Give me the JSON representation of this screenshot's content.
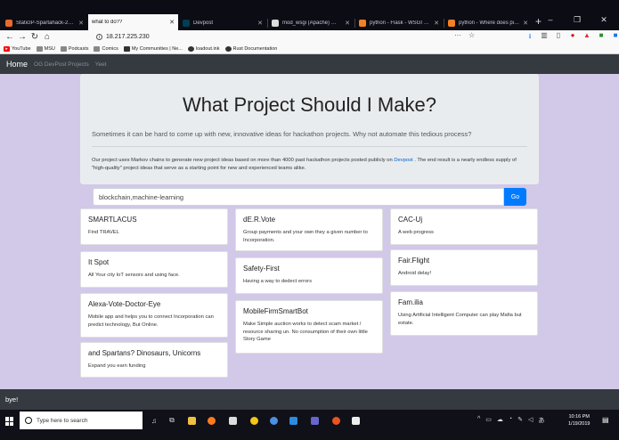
{
  "browser": {
    "tabs": [
      {
        "label": "StaticIP-Spartahack-2019 | Lo",
        "color": "#e86a2c",
        "active": false
      },
      {
        "label": "what to do??",
        "color": "#ffffff",
        "active": true
      },
      {
        "label": "Devpost",
        "color": "#003e54",
        "active": false
      },
      {
        "label": "mod_wsgi (Apache) — Flask",
        "color": "#dddddd",
        "active": false
      },
      {
        "label": "python - Flask - WSGI - No m",
        "color": "#f48024",
        "active": false
      },
      {
        "label": "python - Where does pip ins",
        "color": "#f48024",
        "active": false
      }
    ],
    "new_tab": "+",
    "window_controls": {
      "minimize": "–",
      "maximize": "❐",
      "close": "✕"
    },
    "url": "18.217.225.230",
    "url_actions": {
      "more": "···",
      "star": "☆"
    },
    "bookmarks": [
      {
        "label": "YouTube",
        "icon_color": "#ff0000"
      },
      {
        "label": "MSU",
        "icon_color": "#888888"
      },
      {
        "label": "Podcasts",
        "icon_color": "#888888"
      },
      {
        "label": "Comics",
        "icon_color": "#888888"
      },
      {
        "label": "My Communities | Ne...",
        "icon_color": "#333333"
      },
      {
        "label": "loadout.ink",
        "icon_color": "#333333"
      },
      {
        "label": "Rust Documentation",
        "icon_color": "#333333"
      }
    ]
  },
  "site": {
    "brand": "Home",
    "nav_links": [
      "OG DevPost Projects",
      "Yeet"
    ],
    "title": "What Project Should I Make?",
    "lead": "Sometimes it can be hard to come up with new, innovative ideas for hackathon projects. Why not automate this tedious process?",
    "desc_before": "Our project uses Markov chains to generate new project ideas based on more than 4000 past hackathon projects posted publicly on ",
    "desc_link": "Devpost",
    "desc_after": " . The end result is a nearly endless supply of \"high-quality\" project ideas that serve as a starting point for new and experienced teams alike.",
    "search_value": "blockchain,machine-learning",
    "go_label": "Go",
    "footer": "bye!"
  },
  "cards": [
    {
      "title": "SMARTLACUS",
      "text": "Find TRAVEL"
    },
    {
      "title": "dE.R.Vote",
      "text": "Group payments and your own they a given number to Incorporation."
    },
    {
      "title": "CAC-Uj",
      "text": "A web progress"
    },
    {
      "title": "It Spot",
      "text": "All Your city IoT sensors and using face."
    },
    {
      "title": "Safety-First",
      "text": "Having a way to dedect errors"
    },
    {
      "title": "Fair.Flight",
      "text": "Android delay!"
    },
    {
      "title": "Alexa-Vote-Doctor-Eye",
      "text": "Mobile app and helps you to connect Incorporation can predict technology, But Online."
    },
    {
      "title": "MobileFirmSmartBot",
      "text": "Make Simple auction works to detect scam market / resource sharing un. No consumption of their own little Story Game"
    },
    {
      "title": "Fam.ilia",
      "text": "Using Artificial Intelligent Computer can play Mafia but estate."
    },
    {
      "title": "and Spartans? Dinosaurs, Unicorns",
      "text": "Expand you earn funding"
    }
  ],
  "taskbar": {
    "search_placeholder": "Type here to search",
    "time": "10:16 PM",
    "date": "1/19/2019"
  }
}
